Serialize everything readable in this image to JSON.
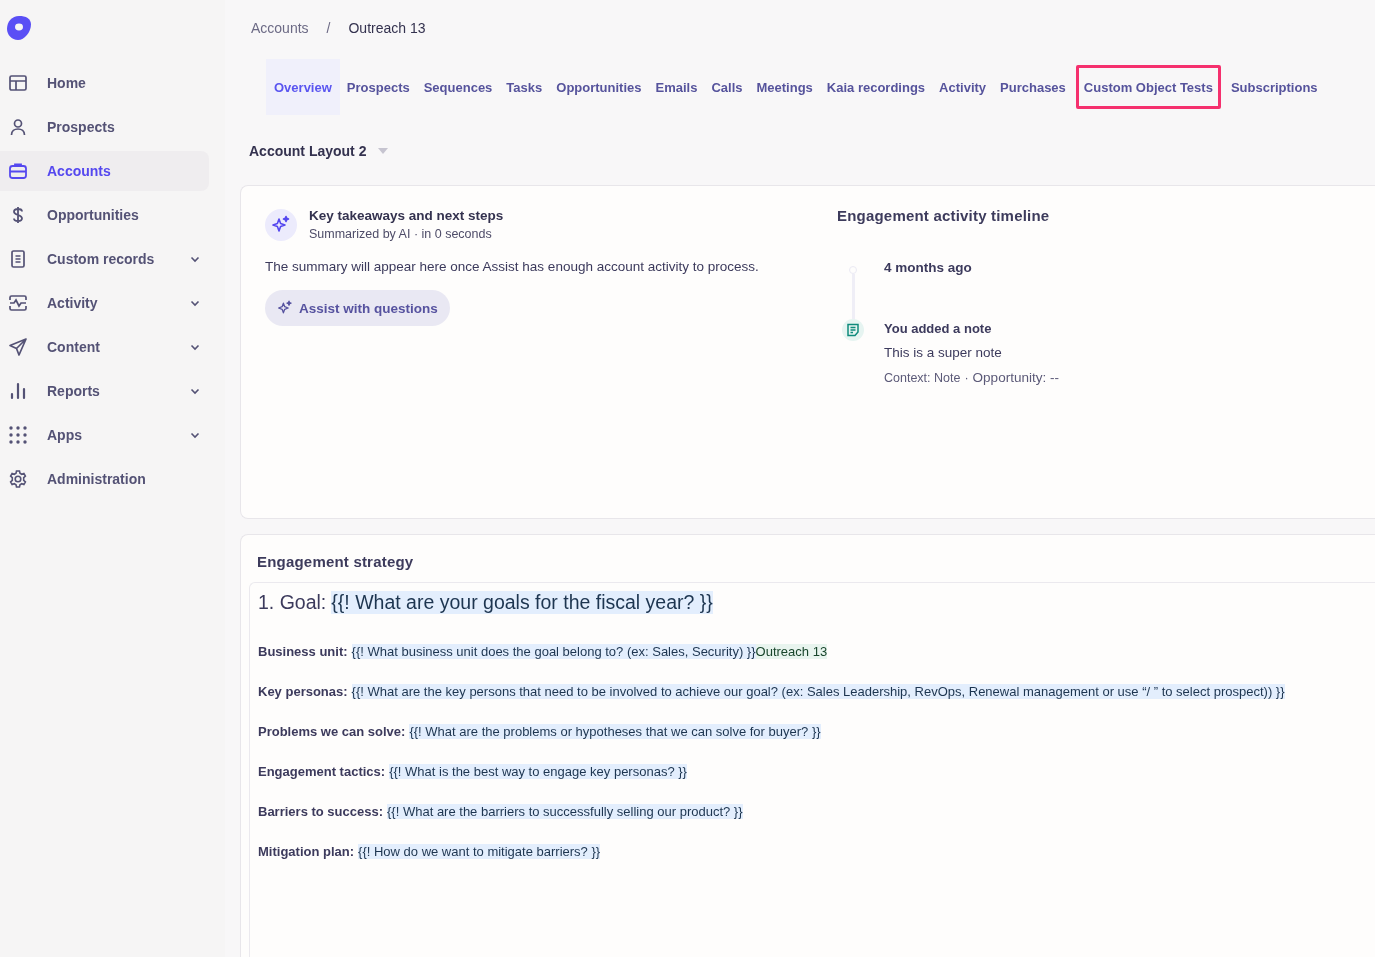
{
  "sidebar": {
    "items": [
      {
        "label": "Home",
        "selected": false,
        "expandable": false
      },
      {
        "label": "Prospects",
        "selected": false,
        "expandable": false
      },
      {
        "label": "Accounts",
        "selected": true,
        "expandable": false
      },
      {
        "label": "Opportunities",
        "selected": false,
        "expandable": false
      },
      {
        "label": "Custom records",
        "selected": false,
        "expandable": true
      },
      {
        "label": "Activity",
        "selected": false,
        "expandable": true
      },
      {
        "label": "Content",
        "selected": false,
        "expandable": true
      },
      {
        "label": "Reports",
        "selected": false,
        "expandable": true
      },
      {
        "label": "Apps",
        "selected": false,
        "expandable": true
      },
      {
        "label": "Administration",
        "selected": false,
        "expandable": false
      }
    ]
  },
  "breadcrumb": [
    "Accounts",
    "Outreach 13"
  ],
  "breadcrumb_separator": "/",
  "tabs": [
    {
      "label": "Overview",
      "selected": true,
      "highlighted": false
    },
    {
      "label": "Prospects",
      "selected": false,
      "highlighted": false
    },
    {
      "label": "Sequences",
      "selected": false,
      "highlighted": false
    },
    {
      "label": "Tasks",
      "selected": false,
      "highlighted": false
    },
    {
      "label": "Opportunities",
      "selected": false,
      "highlighted": false
    },
    {
      "label": "Emails",
      "selected": false,
      "highlighted": false
    },
    {
      "label": "Calls",
      "selected": false,
      "highlighted": false
    },
    {
      "label": "Meetings",
      "selected": false,
      "highlighted": false
    },
    {
      "label": "Kaia recordings",
      "selected": false,
      "highlighted": false
    },
    {
      "label": "Activity",
      "selected": false,
      "highlighted": false
    },
    {
      "label": "Purchases",
      "selected": false,
      "highlighted": false
    },
    {
      "label": "Custom Object Tests",
      "selected": false,
      "highlighted": true
    },
    {
      "label": "Subscriptions",
      "selected": false,
      "highlighted": false
    }
  ],
  "layout_selector": {
    "value": "Account Layout 2"
  },
  "summary": {
    "title": "Key takeaways and next steps",
    "subtitle": "Summarized by AI · in 0 seconds",
    "message": "The summary will appear here once Assist has enough account activity to process.",
    "button": "Assist with questions"
  },
  "timeline": {
    "title": "Engagement activity timeline",
    "entries": [
      {
        "kind": "date",
        "text": "4 months ago"
      },
      {
        "kind": "note",
        "title": "You added a note",
        "body": "This is a super note",
        "context": "Context: Note",
        "separator": "·",
        "opportunity": "Opportunity: --"
      }
    ]
  },
  "strategy": {
    "title": "Engagement strategy",
    "goal": {
      "label": "1. Goal:",
      "template": "{{! What are your goals for the fiscal year? }}"
    },
    "fields": [
      {
        "label": "Business unit:",
        "template": "{{! What business unit does the goal belong to? (ex: Sales, Security) }}",
        "value": "Outreach 13"
      },
      {
        "label": "Key personas:",
        "template": "{{! What are the key persons that need to be involved to achieve our goal? (ex: Sales Leadership, RevOps, Renewal management or use “/ ” to select prospect)) }}"
      },
      {
        "label": "Problems we can solve:",
        "template": "{{! What are the problems or hypotheses that we can solve for buyer? }}"
      },
      {
        "label": "Engagement tactics:",
        "template": "{{! What is the best way to engage key personas? }}"
      },
      {
        "label": "Barriers to success:",
        "template": "{{! What are the barriers to successfully selling our product? }}"
      },
      {
        "label": "Mitigation plan:",
        "template": "{{! How do we want to mitigate barriers? }}"
      }
    ]
  }
}
